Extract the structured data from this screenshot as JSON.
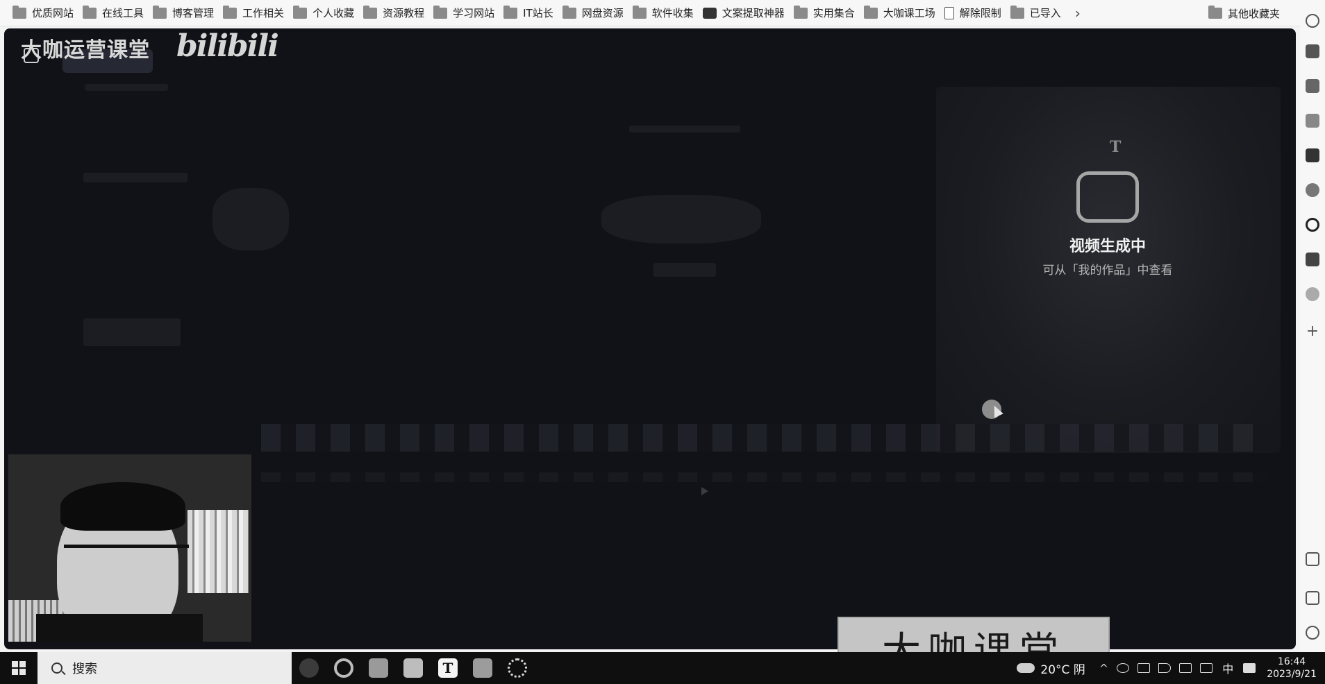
{
  "bookmarks": [
    {
      "label": "优质网站",
      "icon": "folder-icon"
    },
    {
      "label": "在线工具",
      "icon": "folder-icon"
    },
    {
      "label": "博客管理",
      "icon": "folder-icon"
    },
    {
      "label": "工作相关",
      "icon": "folder-icon"
    },
    {
      "label": "个人收藏",
      "icon": "folder-icon"
    },
    {
      "label": "资源教程",
      "icon": "folder-icon"
    },
    {
      "label": "学习网站",
      "icon": "folder-icon"
    },
    {
      "label": "IT站长",
      "icon": "folder-icon"
    },
    {
      "label": "网盘资源",
      "icon": "folder-icon"
    },
    {
      "label": "软件收集",
      "icon": "folder-icon"
    },
    {
      "label": "文案提取神器",
      "icon": "app-badge-icon"
    },
    {
      "label": "实用集合",
      "icon": "folder-icon"
    },
    {
      "label": "大咖课工场",
      "icon": "folder-icon"
    },
    {
      "label": "解除限制",
      "icon": "document-icon"
    },
    {
      "label": "已导入",
      "icon": "folder-icon"
    }
  ],
  "bookmarks_more": "›",
  "other_bookmarks": "其他收藏夹",
  "overlay": {
    "brand": "大咖运营课堂",
    "logo": "bilibili"
  },
  "preview": {
    "title": "视频生成中",
    "subtitle": "可从「我的作品」中查看",
    "mark": "T"
  },
  "stamp": "大咖课堂",
  "taskbar": {
    "search_placeholder": "搜索",
    "weather": "20°C 阴",
    "ime": "中",
    "time": "16:44",
    "date": "2023/9/21"
  },
  "colors": {
    "window_bg": "#111217",
    "taskbar_bg": "#0f0f10"
  }
}
